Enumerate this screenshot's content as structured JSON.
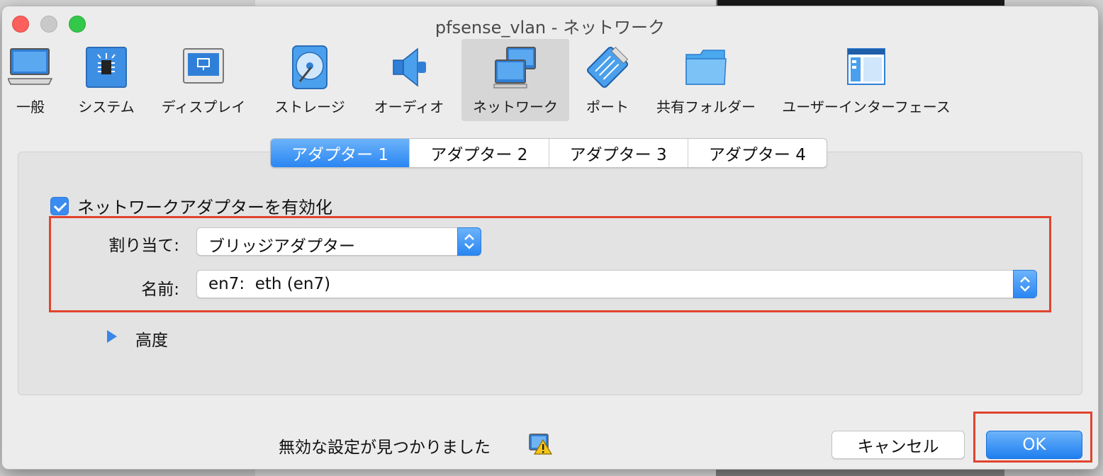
{
  "window": {
    "title": "pfsense_vlan - ネットワーク"
  },
  "toolbar": {
    "items": [
      {
        "label": "一般",
        "icon": "general-monitor-icon"
      },
      {
        "label": "システム",
        "icon": "chip-icon"
      },
      {
        "label": "ディスプレイ",
        "icon": "display-icon"
      },
      {
        "label": "ストレージ",
        "icon": "storage-disk-icon"
      },
      {
        "label": "オーディオ",
        "icon": "speaker-icon"
      },
      {
        "label": "ネットワーク",
        "icon": "network-icon",
        "active": true
      },
      {
        "label": "ポート",
        "icon": "serial-port-icon"
      },
      {
        "label": "共有フォルダー",
        "icon": "folder-icon"
      },
      {
        "label": "ユーザーインターフェース",
        "icon": "user-interface-icon"
      }
    ]
  },
  "tabs": [
    {
      "label": "アダプター 1",
      "active": true
    },
    {
      "label": "アダプター 2"
    },
    {
      "label": "アダプター 3"
    },
    {
      "label": "アダプター 4"
    }
  ],
  "adapter": {
    "enable_label": "ネットワークアダプターを有効化",
    "enabled": true,
    "attachment_label": "割り当て:",
    "attachment_value": "ブリッジアダプター",
    "name_label": "名前:",
    "name_value": "en7:  eth (en7)",
    "advanced_label": "高度"
  },
  "footer": {
    "status_text": "無効な設定が見つかりました",
    "cancel_label": "キャンセル",
    "ok_label": "OK"
  },
  "colors": {
    "accent": "#2a86f2",
    "highlight_box": "#e0442e"
  }
}
